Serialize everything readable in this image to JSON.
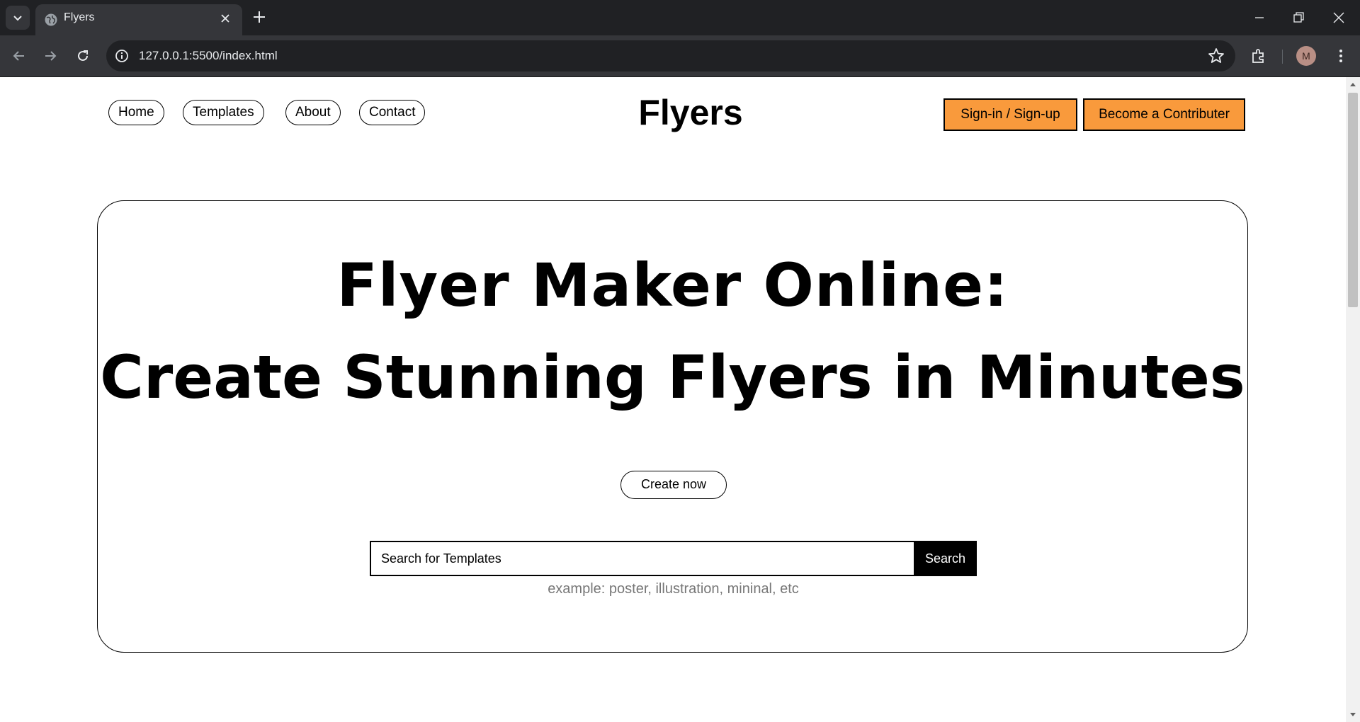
{
  "browser": {
    "tab_title": "Flyers",
    "url": "127.0.0.1:5500/index.html",
    "profile_initial": "M",
    "icons": [
      "tab-search-icon",
      "globe-icon",
      "close-icon",
      "plus-icon",
      "minimize-icon",
      "restore-icon",
      "close-window-icon",
      "back-icon",
      "forward-icon",
      "reload-icon",
      "site-info-icon",
      "star-icon",
      "extensions-icon",
      "menu-icon"
    ]
  },
  "nav": {
    "items": [
      "Home",
      "Templates",
      "About",
      "Contact"
    ],
    "brand": "Flyers",
    "signin_label": "Sign-in / Sign-up",
    "contributor_label": "Become a Contributer"
  },
  "hero": {
    "title_line1": "Flyer Maker Online:",
    "title_line2": "Create Stunning Flyers in Minutes",
    "cta_label": "Create now",
    "search_placeholder": "Search for Templates",
    "search_button": "Search",
    "search_hint": "example: poster, illustration, mininal, etc"
  },
  "colors": {
    "accent": "#f99a3c",
    "browser_dark": "#202124",
    "browser_toolbar": "#35363a"
  }
}
